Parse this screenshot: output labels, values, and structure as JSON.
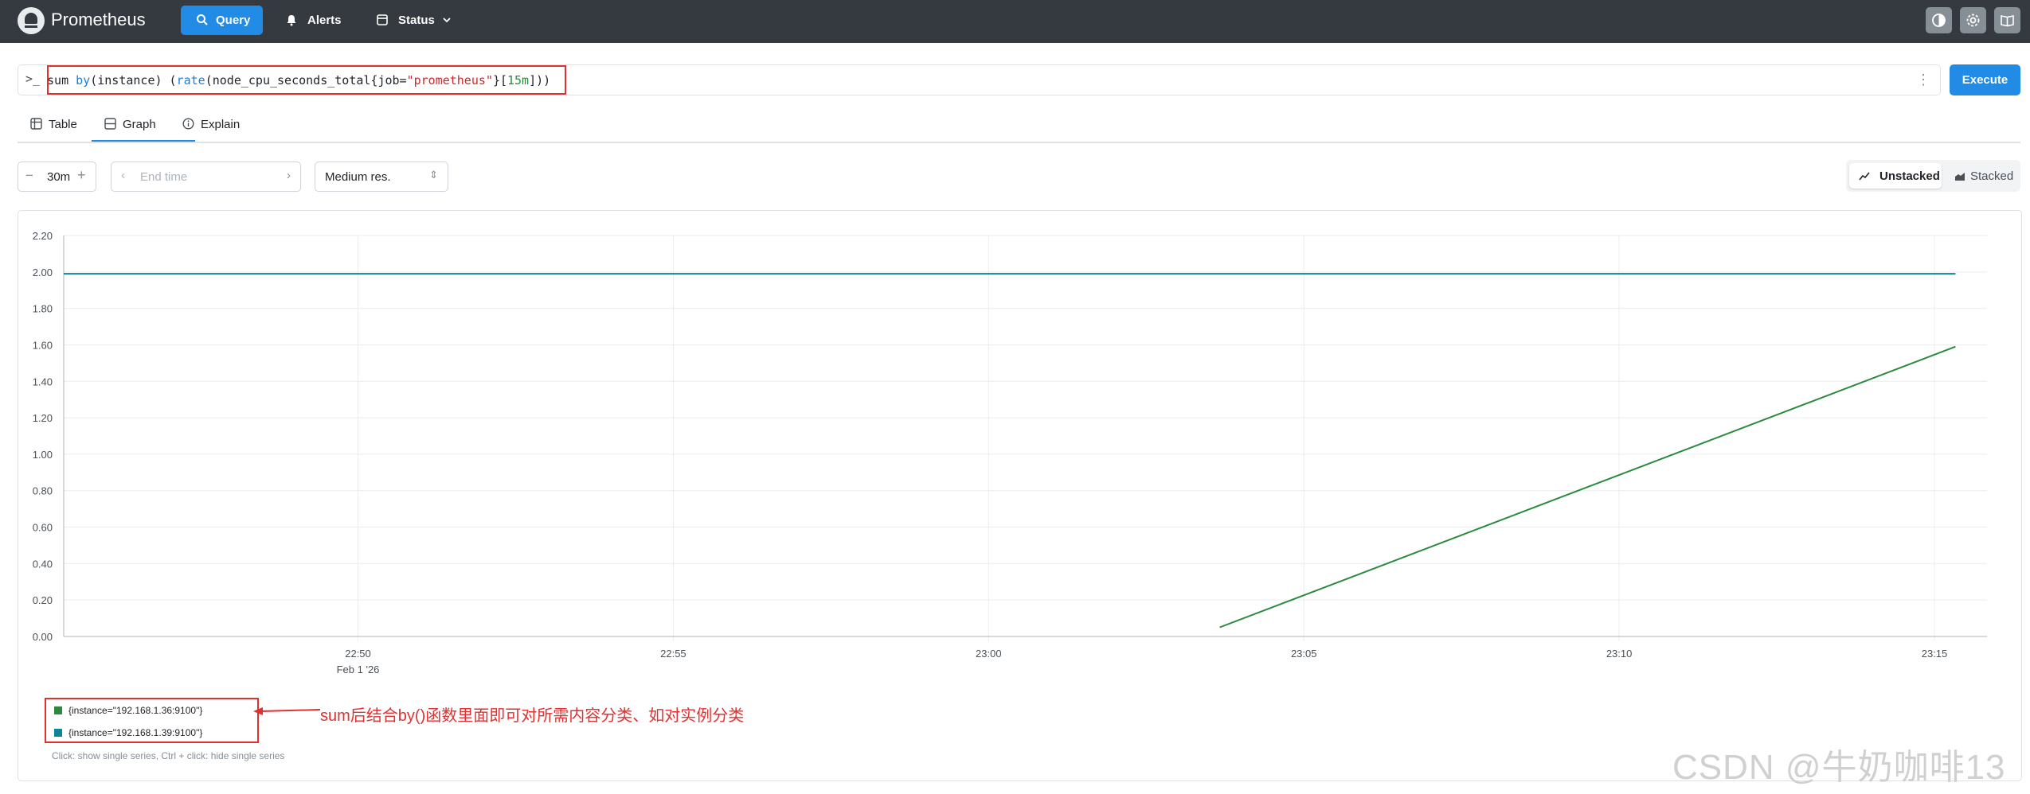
{
  "app": {
    "brand": "Prometheus",
    "nav": [
      {
        "label": "Query",
        "icon": "search-icon",
        "active": true
      },
      {
        "label": "Alerts",
        "icon": "bell-icon"
      },
      {
        "label": "Status",
        "icon": "server-icon"
      }
    ],
    "toolbar_icons": [
      "theme-toggle-icon",
      "gear-icon",
      "book-icon"
    ]
  },
  "query": {
    "prompt": ">_",
    "expression": "sum by(instance) (rate(node_cpu_seconds_total{job=\"prometheus\"}[15m]))",
    "execute_label": "Execute",
    "menu_icon": "more-vertical-icon"
  },
  "tabs": [
    {
      "label": "Table",
      "icon": "table-icon"
    },
    {
      "label": "Graph",
      "icon": "graph-icon",
      "active": true
    },
    {
      "label": "Explain",
      "icon": "info-icon"
    }
  ],
  "controls": {
    "range": "30m",
    "end_time_placeholder": "End time",
    "resolution": "Medium res.",
    "stacking": [
      {
        "label": "Unstacked",
        "active": true
      },
      {
        "label": "Stacked"
      }
    ]
  },
  "chart_data": {
    "type": "line",
    "title": "",
    "xlabel": "",
    "ylabel": "",
    "ylim": [
      0,
      2.2
    ],
    "y_ticks": [
      "0.00",
      "0.20",
      "0.40",
      "0.60",
      "0.80",
      "1.00",
      "1.20",
      "1.40",
      "1.60",
      "1.80",
      "2.00",
      "2.20"
    ],
    "x_ticks": [
      "22:50",
      "22:55",
      "23:00",
      "23:05",
      "23:10",
      "23:15"
    ],
    "x_date_label": "Feb 1 '26",
    "grid": true,
    "series": [
      {
        "name": "{instance=\"192.168.1.36:9100\"}",
        "color": "#2b8a3e",
        "x": [
          "23:03:40",
          "23:15:20"
        ],
        "y": [
          0.05,
          1.59
        ]
      },
      {
        "name": "{instance=\"192.168.1.39:9100\"}",
        "color": "#0c8599",
        "x": [
          "22:45:20",
          "23:02:40",
          "23:15:20"
        ],
        "y": [
          1.99,
          1.99,
          1.99
        ]
      }
    ]
  },
  "legend": {
    "items": [
      {
        "label": "{instance=\"192.168.1.36:9100\"}",
        "color": "#2b8a3e"
      },
      {
        "label": "{instance=\"192.168.1.39:9100\"}",
        "color": "#0c8599"
      }
    ],
    "hint": "Click: show single series, Ctrl + click: hide single series"
  },
  "annotation": {
    "text": "sum后结合by()函数里面即可对所需内容分类、如对实例分类"
  },
  "watermark": "CSDN @牛奶咖啡13"
}
